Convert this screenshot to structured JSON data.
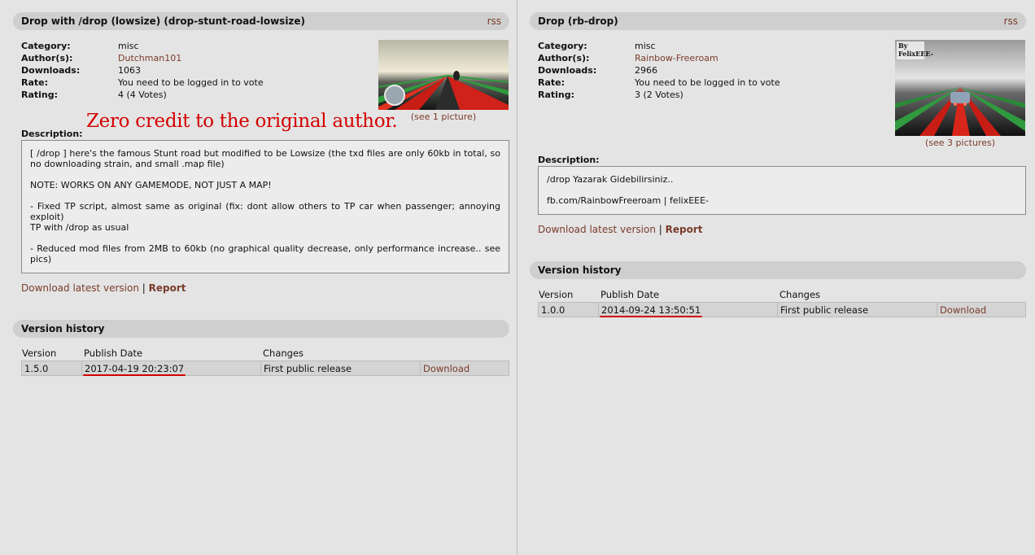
{
  "left": {
    "title": "Drop with /drop (lowsize) (drop-stunt-road-lowsize)",
    "rss": "rss",
    "meta": [
      {
        "key": "Category:",
        "value": "misc",
        "link": false
      },
      {
        "key": "Author(s):",
        "value": "Dutchman101",
        "link": true
      },
      {
        "key": "Downloads:",
        "value": "1063",
        "link": false
      },
      {
        "key": "Rate:",
        "value": "You need to be logged in to vote",
        "link": false
      },
      {
        "key": "Rating:",
        "value": "4 (4 Votes)",
        "link": false
      }
    ],
    "picture_caption": "(see 1 picture)",
    "annotation": "Zero credit to the original author.",
    "description_label": "Description:",
    "description": [
      "[ /drop ] here's the famous Stunt road but modified to be Lowsize (the txd files are only 60kb in total, so no downloading strain, and small .map file)",
      "NOTE: WORKS ON ANY GAMEMODE, NOT JUST A MAP!",
      "- Fixed TP script, almost same as original (fix: dont allow others to TP car when passenger; annoying exploit)\nTP with /drop as usual",
      "- Reduced mod files from 2MB to 60kb (no graphical quality decrease, only performance increase.. see pics)"
    ],
    "download_latest": "Download latest version",
    "separator": "|",
    "report": "Report",
    "version_history_title": "Version history",
    "version_headers": [
      "Version",
      "Publish Date",
      "Changes"
    ],
    "versions": [
      {
        "version": "1.5.0",
        "date": "2017-04-19 20:23:07",
        "changes": "First public release",
        "download": "Download"
      }
    ]
  },
  "right": {
    "title": "Drop (rb-drop)",
    "rss": "rss",
    "meta": [
      {
        "key": "Category:",
        "value": "misc",
        "link": false
      },
      {
        "key": "Author(s):",
        "value": "Rainbow-Freeroam",
        "link": true
      },
      {
        "key": "Downloads:",
        "value": "2966",
        "link": false
      },
      {
        "key": "Rate:",
        "value": "You need to be logged in to vote",
        "link": false
      },
      {
        "key": "Rating:",
        "value": "3 (2 Votes)",
        "link": false
      }
    ],
    "picture_caption": "(see 3 pictures)",
    "thumb_label": "By\nFelixEEE-",
    "description_label": "Description:",
    "description": [
      "/drop Yazarak Gidebilirsiniz..",
      "fb.com/RainbowFreeroam | felixEEE-"
    ],
    "download_latest": "Download latest version",
    "separator": "|",
    "report": "Report",
    "version_history_title": "Version history",
    "version_headers": [
      "Version",
      "Publish Date",
      "Changes"
    ],
    "versions": [
      {
        "version": "1.0.0",
        "date": "2014-09-24 13:50:51",
        "changes": "First public release",
        "download": "Download"
      }
    ]
  },
  "colors": {
    "background": "#e4e4e4",
    "bar": "#cfcfcf",
    "link": "#7a3b2a",
    "annotation": "#d40000"
  }
}
